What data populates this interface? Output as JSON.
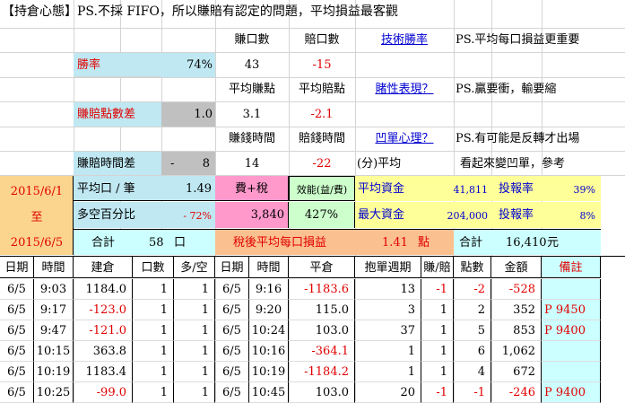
{
  "header": {
    "title": "【持倉心態】PS.不採 FIFO，所以賺賠有認定的問題，平均損益最客觀"
  },
  "summary": {
    "win_count_label": "賺口數",
    "loss_count_label": "賠口數",
    "tech_win_rate": "技術勝率",
    "ps1": "PS.平均每口損益更重要",
    "win_rate_label": "勝率",
    "win_rate": "74%",
    "win_count": "43",
    "loss_count": "-15",
    "avg_win_pts_label": "平均賺點",
    "avg_loss_pts_label": "平均賠點",
    "gamble_nature": "賭性表現？",
    "ps2": "PS.贏要衝，輸要縮",
    "pts_diff_label": "賺賠點數差",
    "pts_diff": "1.0",
    "avg_win_pts": "3.1",
    "avg_loss_pts": "-2.1",
    "win_time_label": "賺錢時間",
    "loss_time_label": "賠錢時間",
    "avg_mindset": "凹單心理？",
    "ps3": "PS.有可能是反轉才出場",
    "time_diff_label": "賺賠時間差",
    "time_diff_sign": "-",
    "time_diff": "8",
    "win_time": "14",
    "loss_time": "-22",
    "min_avg": "(分)平均",
    "ps4": "看起來變凹單，參考"
  },
  "stats": {
    "date_start": "2015/6/1",
    "date_to": "至",
    "date_end": "2015/6/5",
    "avg_per_lot_label": "平均口 / 筆",
    "avg_per_lot": "1.49",
    "fee_tax_label": "費+稅",
    "efficiency_label": "效能(益/費)",
    "avg_capital_label": "平均資金",
    "avg_capital": "41,811",
    "roi_label1": "投報率",
    "roi1": "39%",
    "long_short_label": "多空百分比",
    "long_short": "- 72%",
    "fee_tax": "3,840",
    "efficiency": "427%",
    "max_capital_label": "最大資金",
    "max_capital": "204,000",
    "roi_label2": "投報率",
    "roi2": "8%",
    "total_label": "合計",
    "total_lots": "58",
    "lot_unit": "口",
    "after_tax_label": "稅後平均每口損益",
    "after_tax": "1.41",
    "pts_unit": "點",
    "total_label2": "合計",
    "total_amount": "16,410",
    "money_unit": "元"
  },
  "table": {
    "headers": [
      "日期",
      "時間",
      "建倉",
      "口數",
      "多/空",
      "日期",
      "時間",
      "平倉",
      "抱單週期",
      "賺/賠",
      "點數",
      "金額",
      "備註"
    ],
    "rows": [
      [
        "6/5",
        "9:03",
        "1184.0",
        "1",
        "1",
        "6/5",
        "9:16",
        "-1183.6",
        "13",
        "-1",
        "-2",
        "-528",
        ""
      ],
      [
        "6/5",
        "9:17",
        "-123.0",
        "1",
        "1",
        "6/5",
        "9:20",
        "115.0",
        "3",
        "1",
        "2",
        "352",
        "P 9450"
      ],
      [
        "6/5",
        "9:47",
        "-121.0",
        "1",
        "1",
        "6/5",
        "10:24",
        "103.0",
        "37",
        "1",
        "5",
        "853",
        "P 9400"
      ],
      [
        "6/5",
        "10:15",
        "363.8",
        "1",
        "1",
        "6/5",
        "10:16",
        "-364.1",
        "1",
        "1",
        "6",
        "1,062",
        ""
      ],
      [
        "6/5",
        "10:19",
        "1183.4",
        "1",
        "1",
        "6/5",
        "10:19",
        "-1184.2",
        "1",
        "1",
        "4",
        "672",
        ""
      ],
      [
        "6/5",
        "10:25",
        "-99.0",
        "1",
        "1",
        "6/5",
        "10:45",
        "103.0",
        "20",
        "-1",
        "-1",
        "-246",
        "P 9400"
      ]
    ]
  }
}
